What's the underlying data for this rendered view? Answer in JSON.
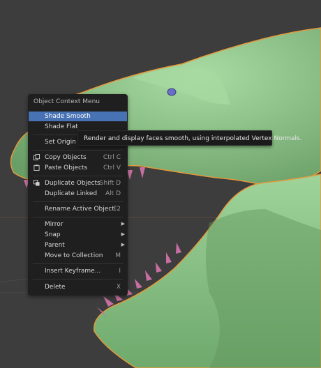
{
  "menu": {
    "title": "Object Context Menu",
    "items": [
      {
        "label": "Shade Smooth",
        "shortcut": "",
        "submenu": false
      },
      {
        "label": "Shade Flat",
        "shortcut": "",
        "submenu": false
      },
      {
        "label": "Set Origin",
        "shortcut": "",
        "submenu": false
      },
      {
        "label": "Copy Objects",
        "shortcut": "Ctrl C",
        "submenu": false
      },
      {
        "label": "Paste Objects",
        "shortcut": "Ctrl V",
        "submenu": false
      },
      {
        "label": "Duplicate Objects",
        "shortcut": "Shift D",
        "submenu": false
      },
      {
        "label": "Duplicate Linked",
        "shortcut": "Alt D",
        "submenu": false
      },
      {
        "label": "Rename Active Object...",
        "shortcut": "F2",
        "submenu": false
      },
      {
        "label": "Mirror",
        "shortcut": "",
        "submenu": true
      },
      {
        "label": "Snap",
        "shortcut": "",
        "submenu": true
      },
      {
        "label": "Parent",
        "shortcut": "",
        "submenu": true
      },
      {
        "label": "Move to Collection",
        "shortcut": "M",
        "submenu": false
      },
      {
        "label": "Insert Keyframe...",
        "shortcut": "I",
        "submenu": false
      },
      {
        "label": "Delete",
        "shortcut": "X",
        "submenu": false
      }
    ]
  },
  "tooltip": {
    "text": "Render and display faces smooth, using interpolated Vertex Normals."
  },
  "colors": {
    "viewport_bg": "#3d3d3d",
    "menu_bg": "#1f1f1f",
    "highlight": "#4772b3",
    "model_green": "#8ec48a",
    "teeth_pink": "#c76fa0",
    "outline_orange": "#e59a3c"
  },
  "icons": {
    "copy": "copy-icon",
    "paste": "paste-icon",
    "duplicate": "duplicate-icon",
    "eye": "eye-icon"
  }
}
